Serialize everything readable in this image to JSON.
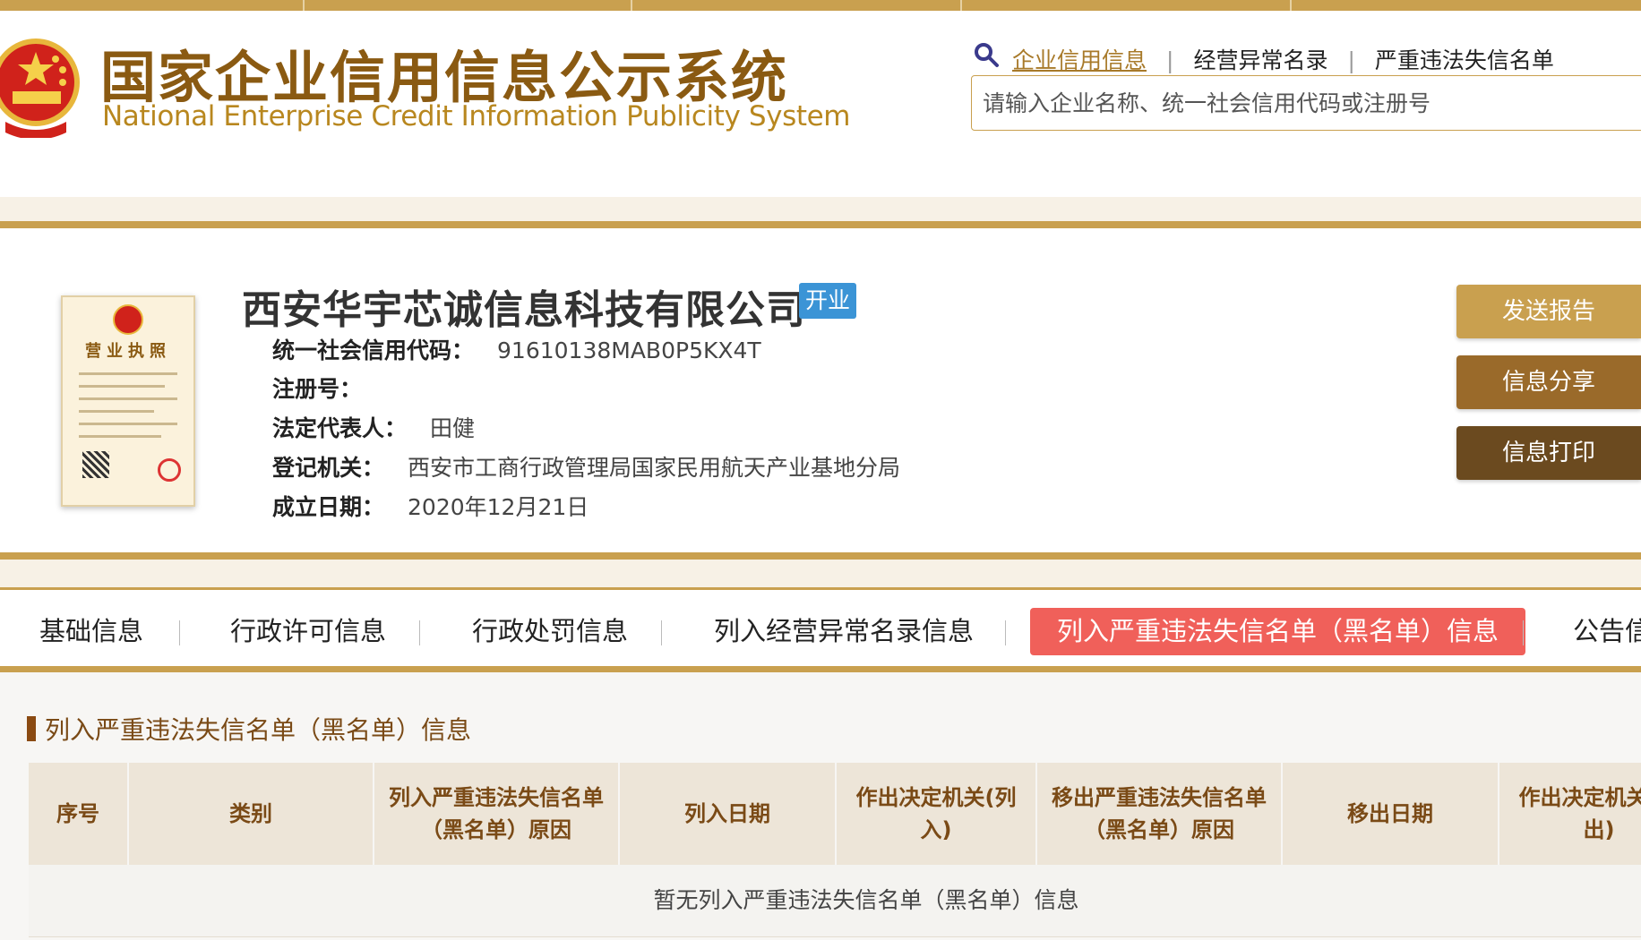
{
  "header": {
    "title_cn": "国家企业信用信息公示系统",
    "title_en": "National Enterprise Credit Information Publicity System",
    "nav": [
      {
        "label": "企业信用信息",
        "active": true
      },
      {
        "label": "经营异常名录",
        "active": false
      },
      {
        "label": "严重违法失信名单",
        "active": false
      }
    ],
    "nav_sep": "|",
    "search_placeholder": "请输入企业名称、统一社会信用代码或注册号"
  },
  "license_image": {
    "title": "营业执照"
  },
  "company": {
    "name": "西安华宇芯诚信息科技有限公司",
    "status": "开业",
    "fields": [
      {
        "label": "统一社会信用代码：",
        "value": "91610138MAB0P5KX4T"
      },
      {
        "label": "注册号：",
        "value": ""
      },
      {
        "label": "法定代表人：",
        "value": "田健"
      },
      {
        "label": "登记机关：",
        "value": "西安市工商行政管理局国家民用航天产业基地分局"
      },
      {
        "label": "成立日期：",
        "value": "2020年12月21日"
      }
    ]
  },
  "actions": {
    "send": "发送报告",
    "share": "信息分享",
    "print": "信息打印"
  },
  "tabs": [
    {
      "label": "基础信息",
      "active": false
    },
    {
      "label": "行政许可信息",
      "active": false
    },
    {
      "label": "行政处罚信息",
      "active": false
    },
    {
      "label": "列入经营异常名录信息",
      "active": false
    },
    {
      "label": "列入严重违法失信名单（黑名单）信息",
      "active": true
    },
    {
      "label": "公告信",
      "active": false
    }
  ],
  "section": {
    "title": "列入严重违法失信名单（黑名单）信息",
    "columns": [
      "序号",
      "类别",
      "列入严重违法失信名单（黑名单）原因",
      "列入日期",
      "作出决定机关(列入)",
      "移出严重违法失信名单（黑名单）原因",
      "移出日期",
      "作出决定机关(移出)"
    ],
    "empty_text": "暂无列入严重违法失信名单（黑名单）信息"
  },
  "colors": {
    "gold": "#c9a04f",
    "brown": "#8a5a12",
    "active_tab": "#f0605a",
    "status_badge": "#3b94d6"
  }
}
